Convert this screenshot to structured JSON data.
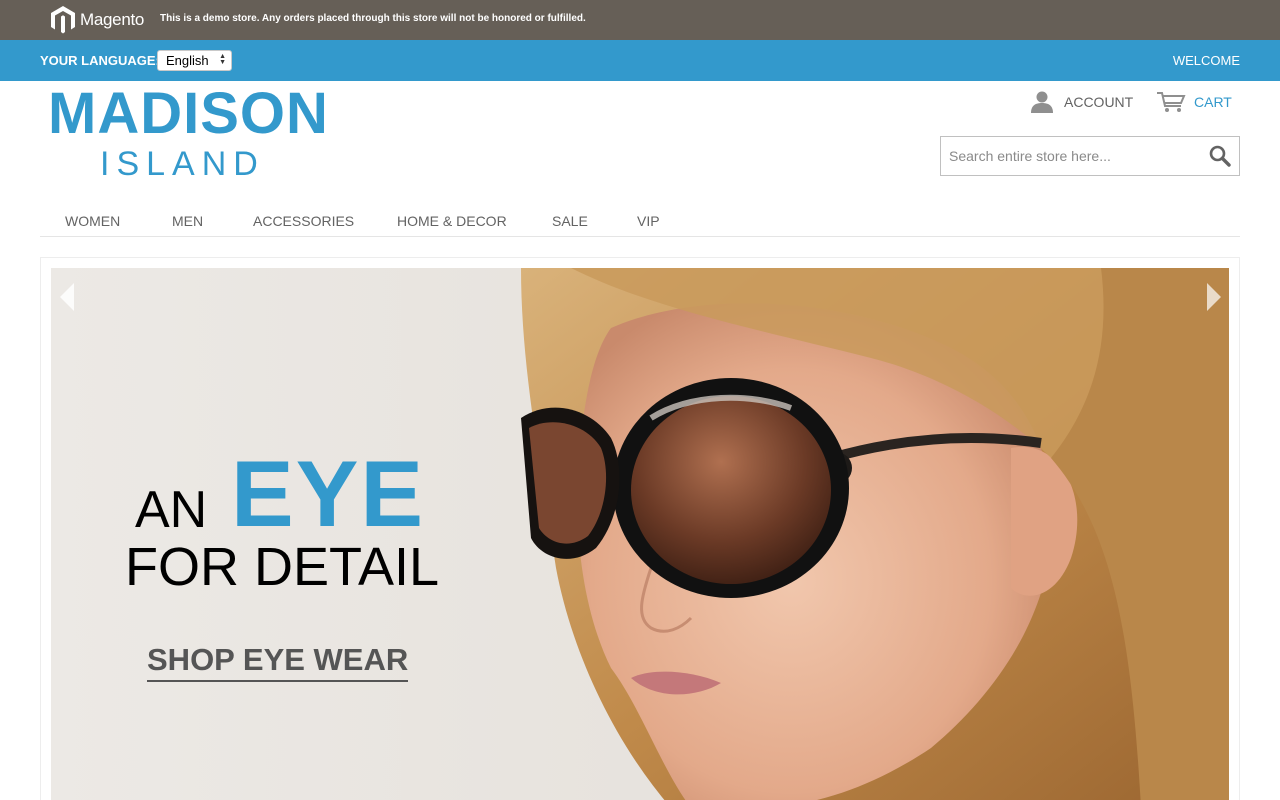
{
  "demo_bar": {
    "brand": "Magento",
    "notice": "This is a demo store. Any orders placed through this store will not be honored or fulfilled."
  },
  "lang_bar": {
    "label": "YOUR LANGUAGE:",
    "selected_language": "English",
    "welcome": "WELCOME"
  },
  "header": {
    "logo_line1": "MADISON",
    "logo_line2": "ISLAND",
    "account_label": "ACCOUNT",
    "cart_label": "CART",
    "search_placeholder": "Search entire store here..."
  },
  "nav": {
    "items": [
      "WOMEN",
      "MEN",
      "ACCESSORIES",
      "HOME & DECOR",
      "SALE",
      "VIP"
    ]
  },
  "hero": {
    "line1_a": "AN",
    "line1_b": "EYE",
    "line2": "FOR DETAIL",
    "cta": "SHOP EYE WEAR"
  },
  "colors": {
    "demo_bar": "#665f57",
    "brand_blue": "#3399cc",
    "text_gray": "#636363"
  },
  "icons": {
    "account": "person-icon",
    "cart": "cart-icon",
    "search": "magnifier-icon",
    "prev": "chevron-left-icon",
    "next": "chevron-right-icon"
  }
}
